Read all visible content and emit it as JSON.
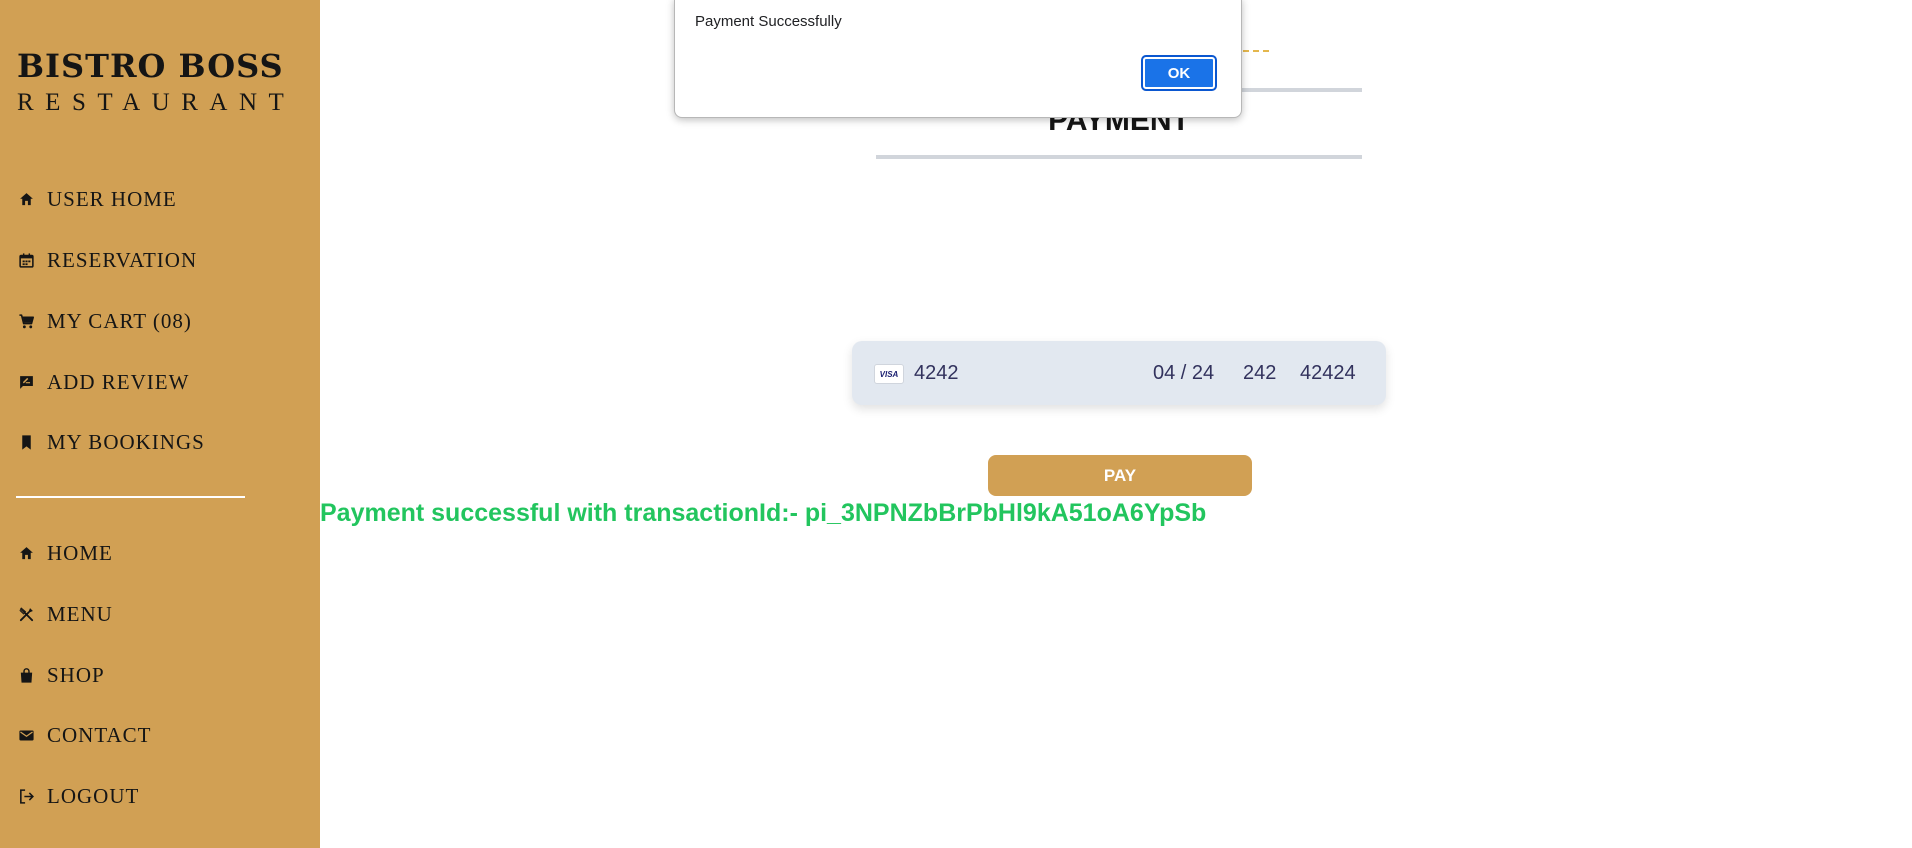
{
  "brand": {
    "title": "BISTRO BOSS",
    "subtitle": "RESTAURANT"
  },
  "sidebar": {
    "primary_items": [
      {
        "label": "USER HOME",
        "icon": "home-icon"
      },
      {
        "label": "RESERVATION",
        "icon": "calendar-icon"
      },
      {
        "label": "MY CART  (08)",
        "icon": "cart-icon"
      },
      {
        "label": "ADD REVIEW",
        "icon": "review-icon"
      },
      {
        "label": "MY BOOKINGS",
        "icon": "bookmark-icon"
      }
    ],
    "secondary_items": [
      {
        "label": "HOME",
        "icon": "home-icon"
      },
      {
        "label": "MENU",
        "icon": "utensils-icon"
      },
      {
        "label": "SHOP",
        "icon": "shopping-bag-icon"
      },
      {
        "label": "CONTACT",
        "icon": "mail-icon"
      },
      {
        "label": "LOGOUT",
        "icon": "logout-icon"
      }
    ]
  },
  "main": {
    "heading": "PAYMENT",
    "card": {
      "brand": "VISA",
      "number": "4242",
      "expiry": "04 / 24",
      "cvc": "242",
      "zip": "42424"
    },
    "pay_label": "PAY",
    "success_message": "Payment successful with transactionId:- pi_3NPNZbBrPbHl9kA51oA6YpSb"
  },
  "alert": {
    "message": "Payment Successfully",
    "ok_label": "OK"
  },
  "colors": {
    "sidebar_bg": "#d1a054",
    "success_text": "#22c55e",
    "ok_button": "#1a73e8",
    "card_bg": "#e2e8f0"
  }
}
